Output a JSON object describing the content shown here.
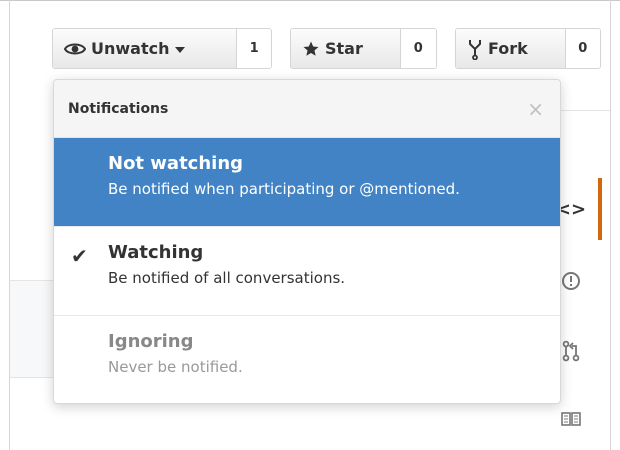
{
  "header_actions": {
    "watch": {
      "label": "Unwatch",
      "count": "1",
      "icon": "eye-icon"
    },
    "star": {
      "label": "Star",
      "count": "0",
      "icon": "star-icon"
    },
    "fork": {
      "label": "Fork",
      "count": "0",
      "icon": "fork-icon"
    }
  },
  "dropdown": {
    "title": "Notifications",
    "close_label": "×",
    "options": [
      {
        "title": "Not watching",
        "description": "Be notified when participating or @mentioned.",
        "state": "highlighted"
      },
      {
        "title": "Watching",
        "description": "Be notified of all conversations.",
        "state": "checked"
      },
      {
        "title": "Ignoring",
        "description": "Never be notified.",
        "state": "normal"
      }
    ]
  },
  "side_nav": {
    "items": [
      {
        "icon": "code-icon",
        "glyph": "<>"
      },
      {
        "icon": "issue-icon",
        "glyph": "!"
      },
      {
        "icon": "pull-request-icon",
        "glyph": "⇅"
      },
      {
        "icon": "book-icon",
        "glyph": "📖"
      }
    ]
  },
  "colors": {
    "accent_blue": "#4183c4",
    "active_orange": "#d26911"
  }
}
